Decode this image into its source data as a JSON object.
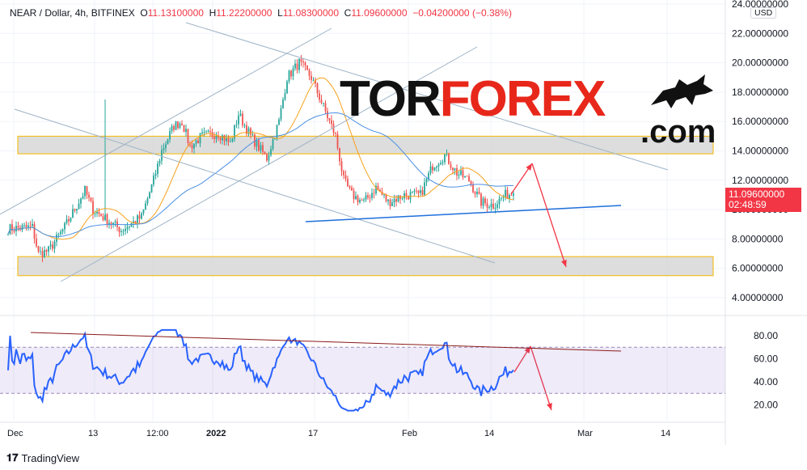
{
  "header": {
    "symbol": "NEAR / Dollar, 4h, BITFINEX",
    "o_label": "O",
    "open": "11.13100000",
    "h_label": "H",
    "high": "11.22200000",
    "l_label": "L",
    "low": "11.08300000",
    "c_label": "C",
    "close": "11.09600000",
    "change": "−0.04200000 (−0.38%)"
  },
  "currency": "USD",
  "last_price": {
    "price": "11.09600000",
    "countdown": "02:48:59"
  },
  "logo": {
    "part1": "TOR",
    "part2": "FOREX",
    "part3": ".com"
  },
  "footer": {
    "brand": "TradingView"
  },
  "colors": {
    "up": "#26a69a",
    "down": "#ef5350",
    "ma_fast": "#f7a21b",
    "ma_slow": "#4a90e2",
    "rsi": "#2962ff",
    "accent": "#f23645"
  },
  "chart_data": {
    "type": "candlestick",
    "title": "NEAR / Dollar, 4h, BITFINEX",
    "ylim": [
      3.5,
      24
    ],
    "y_ticks": [
      "24.00000000",
      "22.00000000",
      "20.00000000",
      "18.00000000",
      "16.00000000",
      "14.00000000",
      "12.00000000",
      "10.00000000",
      "8.00000000",
      "6.00000000",
      "4.00000000"
    ],
    "x_ticks": [
      "Dec",
      "13",
      "12:00",
      "2022",
      "17",
      "Feb",
      "14",
      "Mar",
      "14"
    ],
    "close_keypoints": [
      [
        0,
        8.7
      ],
      [
        12,
        8.8
      ],
      [
        15,
        7.0
      ],
      [
        20,
        7.2
      ],
      [
        28,
        8.8
      ],
      [
        38,
        11.3
      ],
      [
        42,
        10
      ],
      [
        46,
        9.6
      ],
      [
        56,
        8.6
      ],
      [
        66,
        9.5
      ],
      [
        72,
        12
      ],
      [
        76,
        14
      ],
      [
        82,
        15.7
      ],
      [
        86,
        16
      ],
      [
        90,
        14.3
      ],
      [
        96,
        15
      ],
      [
        104,
        15.2
      ],
      [
        110,
        14.5
      ],
      [
        114,
        16.5
      ],
      [
        120,
        15
      ],
      [
        128,
        13.5
      ],
      [
        134,
        16
      ],
      [
        138,
        19
      ],
      [
        144,
        20
      ],
      [
        150,
        19
      ],
      [
        156,
        17
      ],
      [
        162,
        15
      ],
      [
        166,
        12
      ],
      [
        170,
        11
      ],
      [
        176,
        10.5
      ],
      [
        182,
        11.5
      ],
      [
        188,
        10.5
      ],
      [
        196,
        11
      ],
      [
        204,
        11
      ],
      [
        210,
        13
      ],
      [
        216,
        13.7
      ],
      [
        222,
        12.5
      ],
      [
        228,
        12
      ],
      [
        234,
        10.5
      ],
      [
        240,
        10.3
      ],
      [
        246,
        11
      ],
      [
        250,
        11.1
      ]
    ],
    "rsi": {
      "ylim": [
        10,
        90
      ],
      "y_ticks": [
        "80.00",
        "60.00",
        "40.00",
        "20.00"
      ],
      "bands": [
        30,
        70
      ]
    },
    "zones": [
      [
        13.8,
        15.0
      ],
      [
        5.5,
        6.8
      ]
    ]
  }
}
